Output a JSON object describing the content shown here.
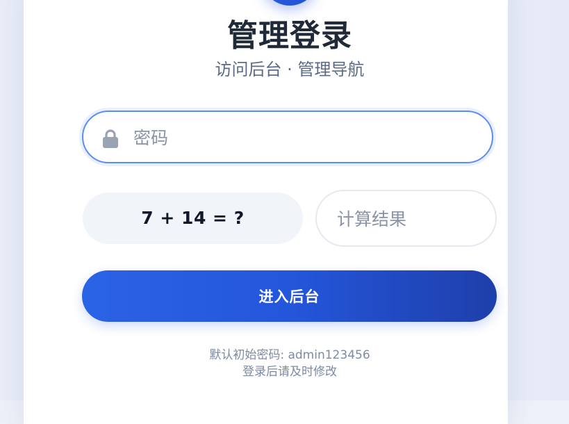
{
  "header": {
    "logo_icon": "compass-icon",
    "title": "管理登录",
    "subtitle": "访问后台 · 管理导航"
  },
  "form": {
    "password": {
      "placeholder": "密码",
      "value": "",
      "icon": "lock-icon"
    },
    "captcha": {
      "question": "7 + 14 = ?",
      "placeholder": "计算结果",
      "value": ""
    },
    "submit_label": "进入后台"
  },
  "footer": {
    "hint_line1": "默认初始密码: admin123456",
    "hint_line2": "登录后请及时修改"
  },
  "colors": {
    "accent": "#2456db",
    "accent_dark": "#1e3faa",
    "focus_border": "#5b8df0"
  }
}
